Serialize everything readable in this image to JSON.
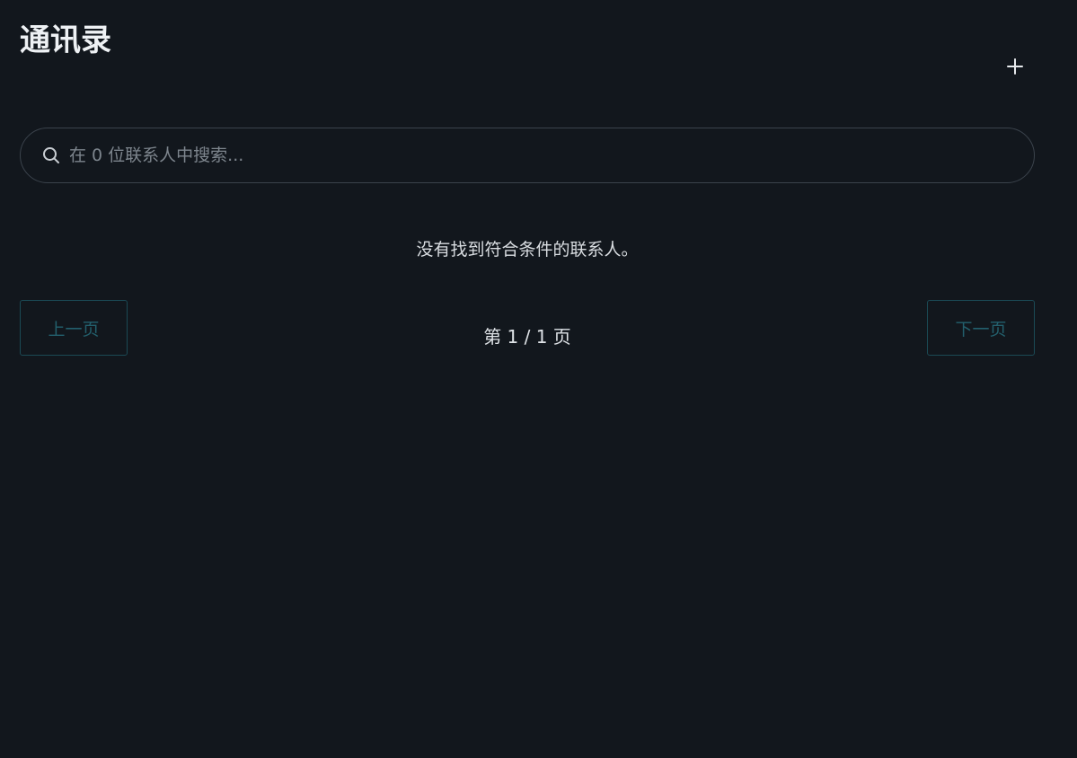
{
  "header": {
    "title": "通讯录",
    "add_icon": "plus-icon"
  },
  "search": {
    "icon": "search-icon",
    "placeholder": "在 0 位联系人中搜索...",
    "value": ""
  },
  "list": {
    "empty_message": "没有找到符合条件的联系人。"
  },
  "pagination": {
    "prev_label": "上一页",
    "next_label": "下一页",
    "page_indicator": "第 1 / 1 页",
    "current_page": 1,
    "total_pages": 1
  },
  "colors": {
    "background": "#12171d",
    "disabled_accent": "#23606d"
  }
}
